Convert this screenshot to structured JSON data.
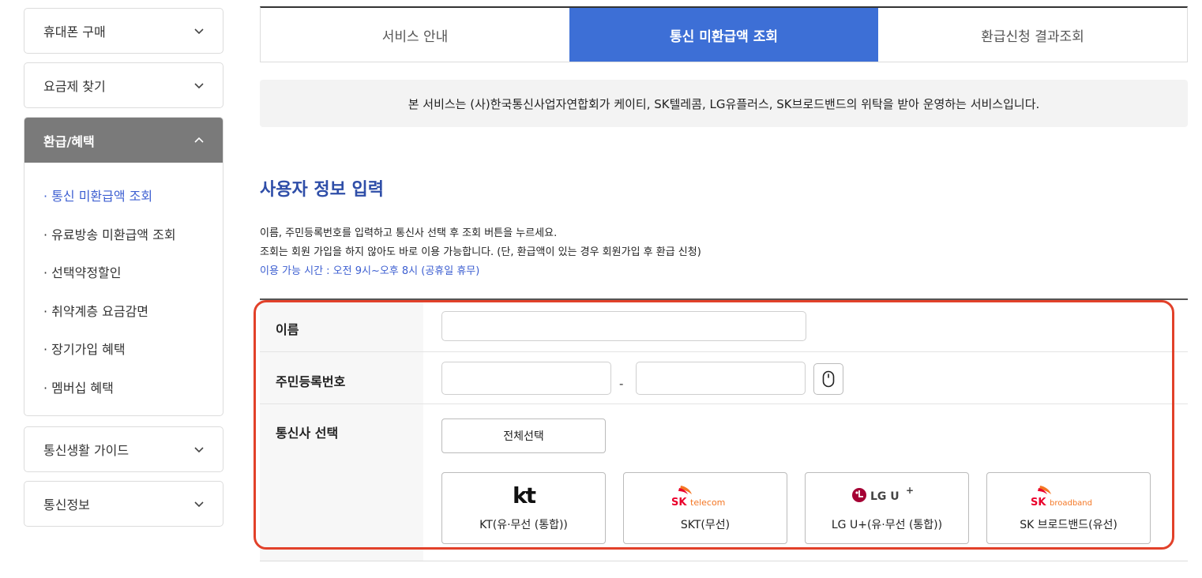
{
  "sidebar": {
    "menus_top": [
      {
        "label": "휴대폰 구매"
      },
      {
        "label": "요금제 찾기"
      }
    ],
    "open_menu": {
      "label": "환급/혜택",
      "items": [
        {
          "label": "· 통신 미환급액 조회",
          "active": true
        },
        {
          "label": "· 유료방송 미환급액 조회"
        },
        {
          "label": "· 선택약정할인"
        },
        {
          "label": "· 취약계층 요금감면"
        },
        {
          "label": "· 장기가입 혜택"
        },
        {
          "label": "· 멤버십 혜택"
        }
      ]
    },
    "menus_bottom": [
      {
        "label": "통신생활 가이드"
      },
      {
        "label": "통신정보"
      }
    ]
  },
  "tabs": [
    {
      "label": "서비스 안내"
    },
    {
      "label": "통신 미환급액 조회",
      "active": true
    },
    {
      "label": "환급신청 결과조회"
    }
  ],
  "notice": "본 서비스는 (사)한국통신사업자연합회가 케이티, SK텔레콤, LG유플러스, SK브로드밴드의 위탁을 받아 운영하는 서비스입니다.",
  "section": {
    "title": "사용자 정보 입력",
    "desc_line1": "이름, 주민등록번호를 입력하고 통신사 선택 후 조회 버튼을 누르세요.",
    "desc_line2": "조회는 회원 가입을 하지 않아도 바로 이용 가능합니다. (단, 환급액이 있는 경우 회원가입 후 환급 신청)",
    "desc_line3": "이용 가능 시간 : 오전 9시~오후 8시 (공휴일 휴무)"
  },
  "form": {
    "name_label": "이름",
    "name_value": "",
    "rrn_label": "주민등록번호",
    "rrn_front_value": "",
    "rrn_back_value": "",
    "rrn_dash": "-",
    "carrier_label": "통신사 선택",
    "select_all": "전체선택",
    "carriers": [
      {
        "name": "KT(유·무선 (통합))",
        "logo": "kt"
      },
      {
        "name": "SKT(무선)",
        "logo_main": "SK",
        "logo_sub": "telecom"
      },
      {
        "name": "LG U+(유·무선 (통합))",
        "logo_main": "LG U",
        "logo_sup": "+"
      },
      {
        "name": "SK 브로드밴드(유선)",
        "logo_main": "SK",
        "logo_sub": "broadband"
      }
    ]
  },
  "colors": {
    "accent": "#3d6fd6",
    "title_blue": "#2f4ea8",
    "highlight": "#e2412a",
    "sk_red": "#ea002c",
    "sk_orange": "#f47725",
    "lg_magenta": "#a50034"
  },
  "icons": {
    "chevron": "chevron-down-icon",
    "mouse": "mouse-icon"
  }
}
